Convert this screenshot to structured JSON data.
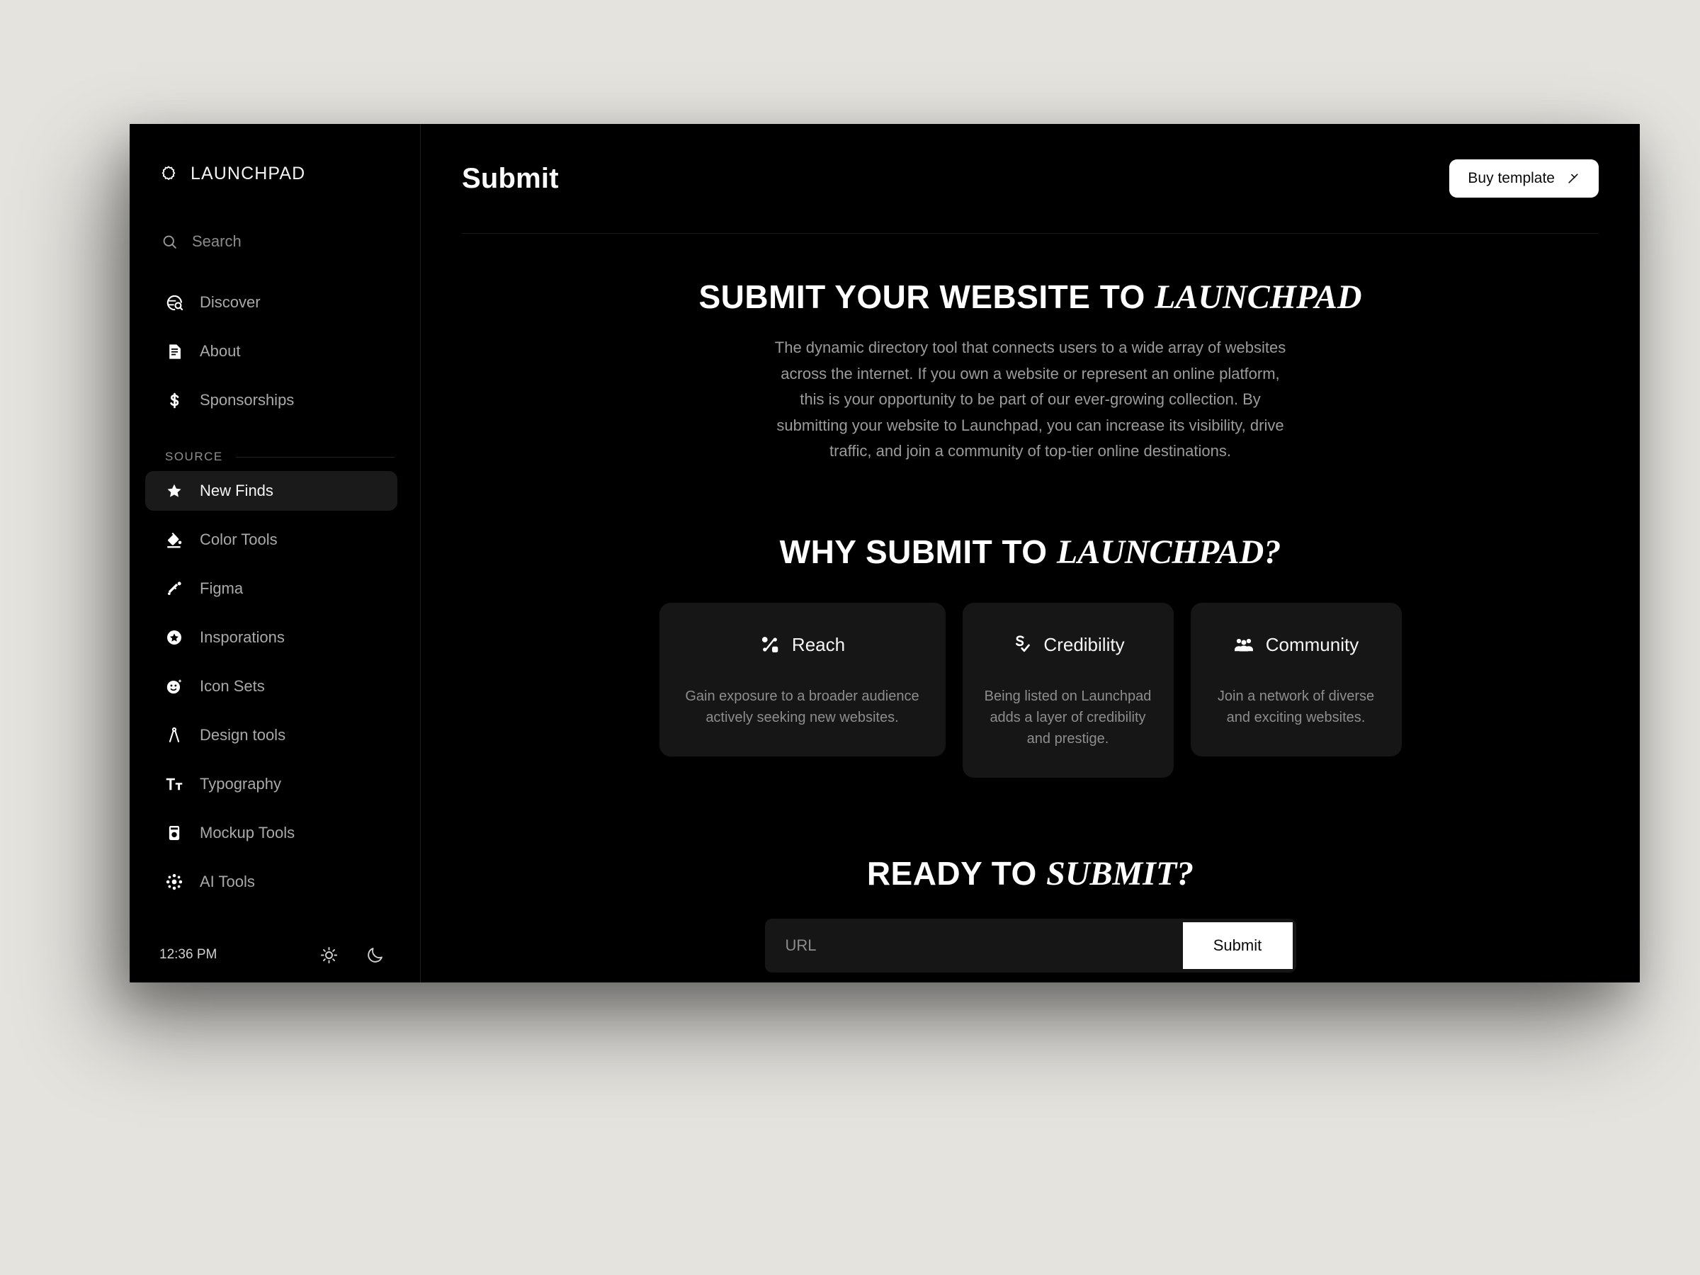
{
  "brand": {
    "name": "LAUNCHPAD",
    "logo_icon": "scalloped-badge-icon"
  },
  "sidebar": {
    "search": {
      "placeholder": "Search",
      "icon": "search-icon"
    },
    "primary_items": [
      {
        "label": "Discover",
        "icon": "globe-search-icon",
        "active": false
      },
      {
        "label": "About",
        "icon": "document-icon",
        "active": false
      },
      {
        "label": "Sponsorships",
        "icon": "dollar-icon",
        "active": false
      }
    ],
    "source_section": {
      "title": "SOURCE",
      "items": [
        {
          "label": "New Finds",
          "icon": "star-icon",
          "active": true
        },
        {
          "label": "Color Tools",
          "icon": "paint-bucket-icon",
          "active": false
        },
        {
          "label": "Figma",
          "icon": "figma-icon",
          "active": false
        },
        {
          "label": "Insporations",
          "icon": "star-badge-icon",
          "active": false
        },
        {
          "label": "Icon Sets",
          "icon": "smiley-sparkle-icon",
          "active": false
        },
        {
          "label": "Design tools",
          "icon": "compass-icon",
          "active": false
        },
        {
          "label": "Typography",
          "icon": "text-size-icon",
          "active": false
        },
        {
          "label": "Mockup Tools",
          "icon": "mockup-icon",
          "active": false
        },
        {
          "label": "AI Tools",
          "icon": "ai-nodes-icon",
          "active": false
        }
      ]
    },
    "footer": {
      "clock": "12:36 PM",
      "light_mode_icon": "sun-icon",
      "dark_mode_icon": "moon-icon"
    }
  },
  "topbar": {
    "title": "Submit",
    "buy_template": {
      "label": "Buy template",
      "icon": "sparkle-icon"
    }
  },
  "main": {
    "hero": {
      "heading_plain": "SUBMIT YOUR WEBSITE TO ",
      "heading_emphasis": "LAUNCHPAD",
      "paragraph": "The dynamic directory tool that connects users to a wide array of websites across the internet. If you own a website or represent an online platform, this is your opportunity to be part of our ever-growing collection. By submitting your website to Launchpad, you can increase its visibility, drive traffic, and join a community of top-tier online destinations."
    },
    "why": {
      "heading_plain": "WHY SUBMIT TO ",
      "heading_emphasis": "LAUNCHPAD?",
      "cards": [
        {
          "title": "Reach",
          "icon": "network-share-icon",
          "body": "Gain exposure to a broader audience actively seeking new websites."
        },
        {
          "title": "Credibility",
          "icon": "verified-check-icon",
          "body": "Being listed on Launchpad adds a layer of credibility and prestige."
        },
        {
          "title": "Community",
          "icon": "people-group-icon",
          "body": "Join a network of diverse and exciting websites."
        }
      ]
    },
    "ready": {
      "heading_plain": "READY TO ",
      "heading_emphasis": "SUBMIT?",
      "url_placeholder": "URL",
      "url_value": "",
      "submit_label": "Submit"
    }
  },
  "colors": {
    "page_background": "#e4e3de",
    "window_background": "#000000",
    "card_background": "#161616",
    "active_item_background": "#1a1a1a",
    "accent_button": "#ffffff",
    "muted_text": "#8d8d8d"
  }
}
